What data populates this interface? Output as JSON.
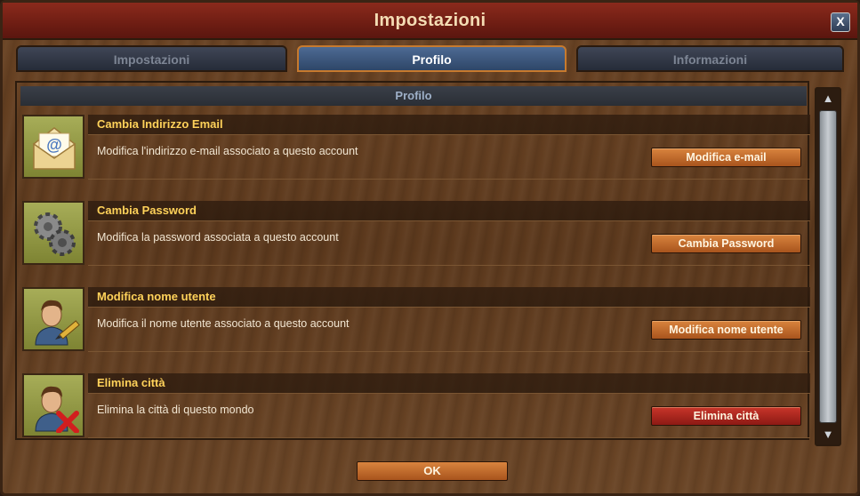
{
  "window": {
    "title": "Impostazioni",
    "close_label": "X"
  },
  "tabs": [
    {
      "label": "Impostazioni",
      "active": false
    },
    {
      "label": "Profilo",
      "active": true
    },
    {
      "label": "Informazioni",
      "active": false
    }
  ],
  "section": {
    "header": "Profilo"
  },
  "rows": [
    {
      "icon": "email-envelope-icon",
      "title": "Cambia Indirizzo Email",
      "description": "Modifica l'indirizzo e-mail associato a questo account",
      "button": "Modifica e-mail"
    },
    {
      "icon": "gears-icon",
      "title": "Cambia Password",
      "description": "Modifica la password associata a questo account",
      "button": "Cambia Password"
    },
    {
      "icon": "user-pencil-icon",
      "title": "Modifica nome utente",
      "description": "Modifica il nome utente associato a questo account",
      "button": "Modifica nome utente"
    },
    {
      "icon": "user-delete-icon",
      "title": "Elimina città",
      "description": "Elimina la città di questo mondo",
      "button": "Elimina città"
    }
  ],
  "footer": {
    "ok_label": "OK"
  },
  "colors": {
    "accent": "#ffd25a",
    "danger": "#c8352a",
    "button": "#d9843e",
    "active_tab": "#4d6a93"
  }
}
